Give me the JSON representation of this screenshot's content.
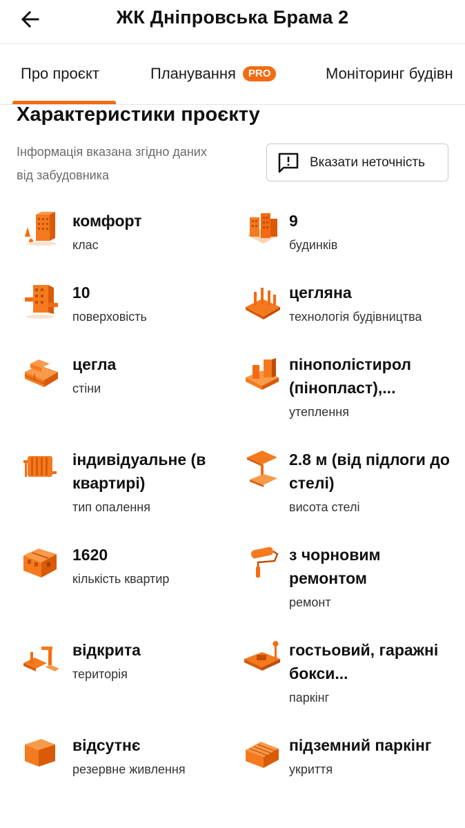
{
  "header": {
    "title": "ЖК Дніпровська Брама 2",
    "back_icon": "arrow-left-icon"
  },
  "tabs": [
    {
      "label": "Про проєкт",
      "active": true
    },
    {
      "label": "Планування",
      "badge": "PRO"
    },
    {
      "label": "Моніторинг будівн"
    }
  ],
  "accent_color": "#f36b12",
  "section": {
    "title": "Характеристики проєкту",
    "info_line1": "Інформація вказана згідно даних",
    "info_line2": "від забудовника",
    "report_button": "Вказати неточність"
  },
  "characteristics": [
    {
      "value": "комфорт",
      "label": "клас",
      "icon": "building-class-icon"
    },
    {
      "value": "9",
      "label": "будинків",
      "icon": "buildings-icon"
    },
    {
      "value": "10",
      "label": "поверховість",
      "icon": "floors-icon"
    },
    {
      "value": "цегляна",
      "label": "технологія будівництва",
      "icon": "construction-tech-icon"
    },
    {
      "value": "цегла",
      "label": "стіни",
      "icon": "bricks-icon"
    },
    {
      "value": "пінополістирол (пінопласт),...",
      "label": "утеплення",
      "icon": "insulation-icon"
    },
    {
      "value": "індивідуальне (в квартирі)",
      "label": "тип опалення",
      "icon": "radiator-icon"
    },
    {
      "value": "2.8 м (від підлоги до стелі)",
      "label": "висота стелі",
      "icon": "ceiling-height-icon"
    },
    {
      "value": "1620",
      "label": "кількість квартир",
      "icon": "apartments-icon"
    },
    {
      "value": "з чорновим ремонтом",
      "label": "ремонт",
      "icon": "paint-roller-icon"
    },
    {
      "value": "відкрита",
      "label": "територія",
      "icon": "territory-icon"
    },
    {
      "value": "гостьовий, гаражні бокси...",
      "label": "паркінг",
      "icon": "parking-icon"
    },
    {
      "value": "відсутнє",
      "label": "резервне живлення",
      "icon": "battery-icon"
    },
    {
      "value": "підземний паркінг",
      "label": "укриття",
      "icon": "shelter-icon"
    }
  ]
}
